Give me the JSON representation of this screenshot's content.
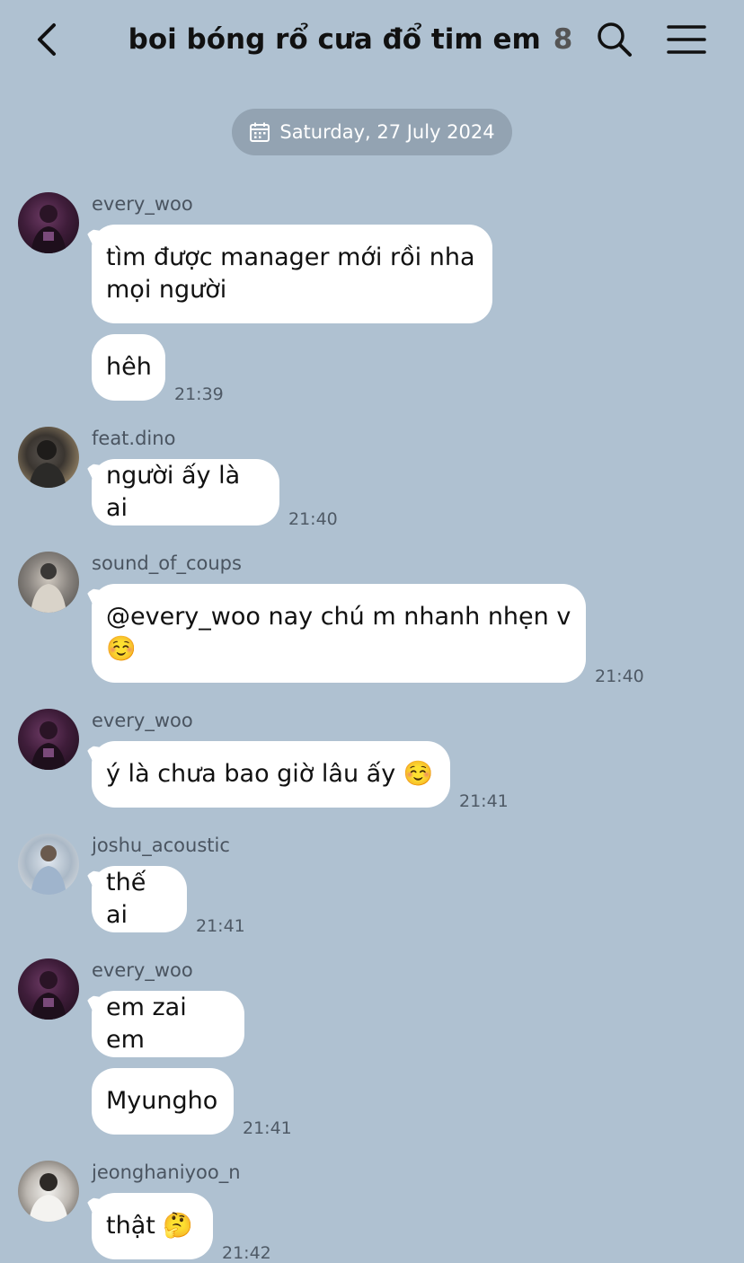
{
  "header": {
    "title": "boi bóng rổ cưa đổ tim em",
    "member_count": "8"
  },
  "date_divider": "Saturday, 27 July 2024",
  "messages": [
    {
      "user": "every_woo",
      "text": "tìm được manager mới rồi nha\nmọi người"
    },
    {
      "text": "hêh",
      "time": "21:39"
    },
    {
      "user": "feat.dino",
      "text": "người ấy là ai",
      "time": "21:40"
    },
    {
      "user": "sound_of_coups",
      "text": "@every_woo nay chú m nhanh nhẹn v\n☺️",
      "time": "21:40"
    },
    {
      "user": "every_woo",
      "text": "ý là chưa bao giờ lâu ấy ☺️",
      "time": "21:41"
    },
    {
      "user": "joshu_acoustic",
      "text": "thế ai",
      "time": "21:41"
    },
    {
      "user": "every_woo",
      "text": "em zai em"
    },
    {
      "text": "Myungho",
      "time": "21:41"
    },
    {
      "user": "jeonghaniyoo_n",
      "text": "thật 🤔",
      "time": "21:42"
    }
  ],
  "icons": {
    "back": "chevron-left-icon",
    "search": "search-icon",
    "menu": "hamburger-menu-icon",
    "calendar": "calendar-icon"
  },
  "colors": {
    "background": "#afc1d1",
    "bubble": "#ffffff",
    "date_pill": "#93a3b2"
  }
}
